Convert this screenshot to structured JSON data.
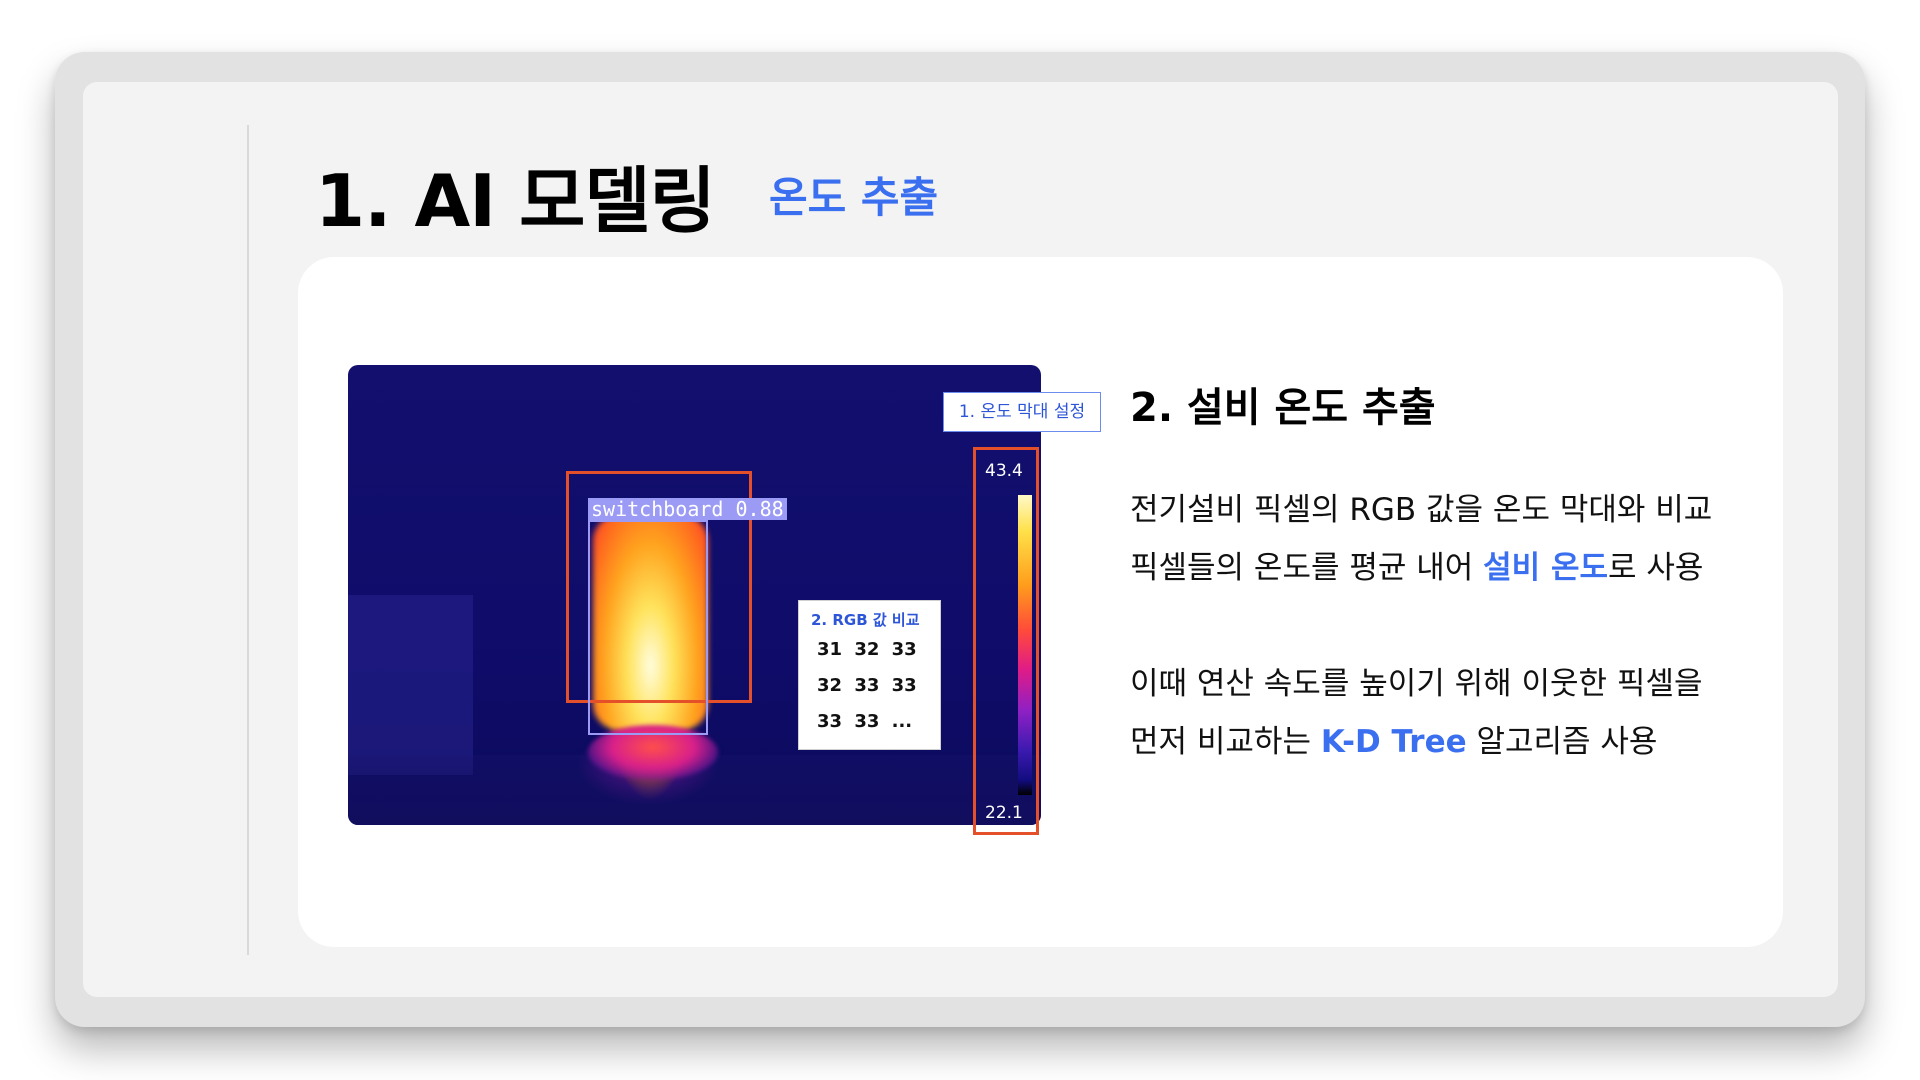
{
  "slide": {
    "title": "1. AI 모델링",
    "subtitle": "온도 추출"
  },
  "thermal_image": {
    "detection_label": "switchboard  0.88",
    "callout_label": "1. 온도 막대 설정",
    "scale_max": "43.4",
    "scale_min": "22.1",
    "rgb_box": {
      "title": "2. RGB 값 비교",
      "rows": [
        "31  32  33",
        "32  33  33",
        "33  33  ..."
      ]
    }
  },
  "content": {
    "heading": "2. 설비 온도 추출",
    "para1_line1": "전기설비 픽셀의 RGB 값을 온도 막대와 비교",
    "para1_line2_pre": "픽셀들의 온도를 평균 내어 ",
    "para1_line2_hl": "설비 온도",
    "para1_line2_post": "로 사용",
    "para2_line1": "이때 연산 속도를 높이기 위해 이웃한 픽셀을",
    "para2_line2_pre": "먼저 비교하는 ",
    "para2_line2_hl": "K-D Tree",
    "para2_line2_post": " 알고리즘 사용"
  },
  "colors": {
    "accent": "#3a6ff0",
    "box_outline": "#e3502a",
    "detection": "#9b9bf5"
  }
}
